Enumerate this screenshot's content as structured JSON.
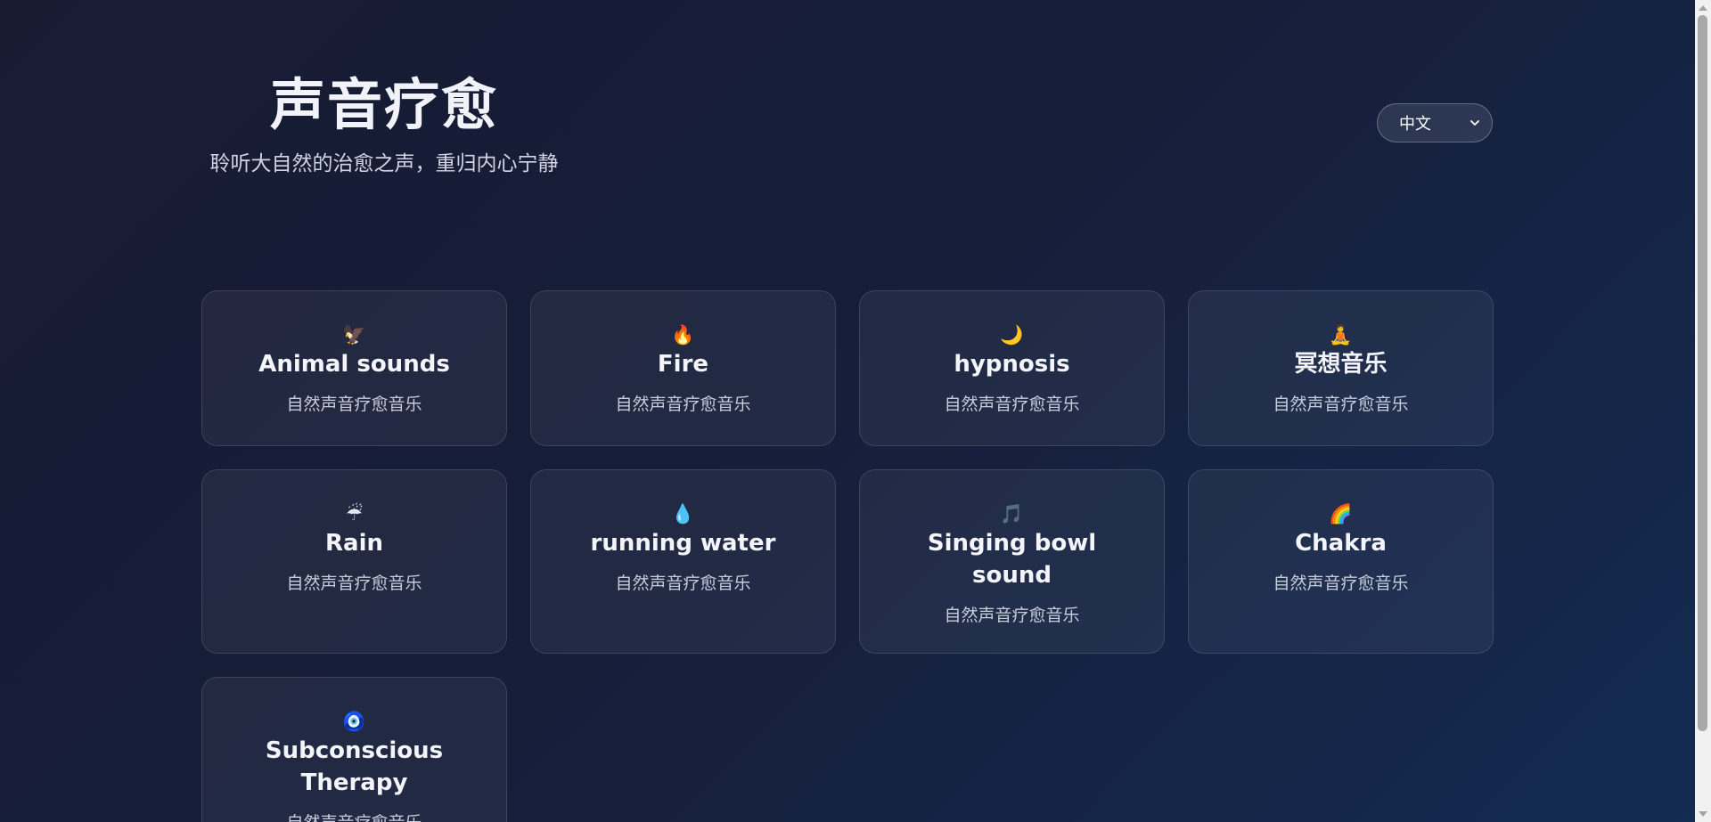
{
  "header": {
    "title": "声音疗愈",
    "subtitle": "聆听大自然的治愈之声，重归内心宁静"
  },
  "language": {
    "selected": "中文"
  },
  "cards": [
    {
      "icon": "🦅",
      "icon_name": "eagle-icon",
      "title": "Animal sounds",
      "desc": "自然声音疗愈音乐"
    },
    {
      "icon": "🔥",
      "icon_name": "fire-icon",
      "title": "Fire",
      "desc": "自然声音疗愈音乐"
    },
    {
      "icon": "🌙",
      "icon_name": "moon-icon",
      "title": "hypnosis",
      "desc": "自然声音疗愈音乐"
    },
    {
      "icon": "🧘",
      "icon_name": "meditation-icon",
      "title": "冥想音乐",
      "desc": "自然声音疗愈音乐"
    },
    {
      "icon": "☔",
      "icon_name": "umbrella-rain-icon",
      "title": "Rain",
      "desc": "自然声音疗愈音乐"
    },
    {
      "icon": "💧",
      "icon_name": "water-drop-icon",
      "title": "running water",
      "desc": "自然声音疗愈音乐"
    },
    {
      "icon": "🎵",
      "icon_name": "music-note-icon",
      "title": "Singing bowl sound",
      "desc": "自然声音疗愈音乐"
    },
    {
      "icon": "🌈",
      "icon_name": "rainbow-icon",
      "title": "Chakra",
      "desc": "自然声音疗愈音乐"
    },
    {
      "icon": "🧿",
      "icon_name": "nazar-eye-icon",
      "title": "Subconscious Therapy",
      "desc": "自然声音疗愈音乐"
    }
  ],
  "colors": {
    "background_start": "#181c33",
    "background_end": "#142b52",
    "card_border": "#2f3752"
  }
}
